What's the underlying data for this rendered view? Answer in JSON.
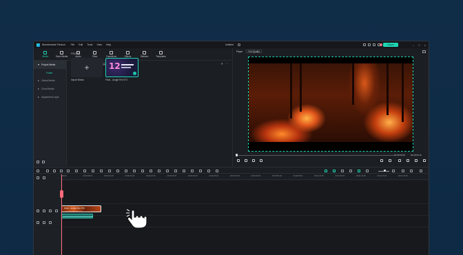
{
  "app": {
    "name": "Wondershare Filmora",
    "menu": [
      "File",
      "Edit",
      "Tools",
      "View",
      "Help"
    ],
    "document_title": "Untitled",
    "export_label": "Export"
  },
  "toolstrip": [
    {
      "label": "Media",
      "icon": "media-icon",
      "active": true
    },
    {
      "label": "Stock Media",
      "icon": "stock-media-icon",
      "active": false
    },
    {
      "label": "Audio",
      "icon": "audio-icon",
      "active": false
    },
    {
      "label": "Titles",
      "icon": "titles-icon",
      "active": false
    },
    {
      "label": "Transitions",
      "icon": "transitions-icon",
      "active": false
    },
    {
      "label": "Effects",
      "icon": "effects-icon",
      "active": false
    },
    {
      "label": "Stickers",
      "icon": "stickers-icon",
      "active": false
    },
    {
      "label": "Templates",
      "icon": "templates-icon",
      "active": false
    }
  ],
  "leftnav": {
    "items": [
      "Project Media",
      "Folder",
      "Global Media",
      "Cloud Media",
      "Adjustment Layer"
    ]
  },
  "media": {
    "import_chip": "Import",
    "ai_image_chip": "AI Image",
    "record_chip": "Record",
    "search_placeholder": "Search media",
    "folder_label": "FOLDER",
    "import_tile_label": "Import Media",
    "clip_name": "Final - Jungle Fire 573"
  },
  "player": {
    "tab": "Player",
    "quality": "Full Quality",
    "time_current": "00:00:00:00",
    "time_total": "00:00:00:15"
  },
  "timeline": {
    "ruler": [
      "00:00",
      "00:00:05:00",
      "00:00:10:00",
      "00:00:15:00",
      "00:00:20:00",
      "00:00:25:00",
      "00:00:30:00",
      "00:00:35:00",
      "00:00:40:00",
      "00:00:45:00",
      "00:00:50:00",
      "00:00:55:00",
      "00:01:00:00",
      "00:01:05:00",
      "00:01:10:00",
      "00:01:15:00",
      "00:01:20:00"
    ],
    "video_clip_label": "Final - Jungle Fire 573"
  },
  "colors": {
    "accent": "#1fd6b3",
    "playhead": "#ff6b7a",
    "background": "#0f2b45"
  }
}
